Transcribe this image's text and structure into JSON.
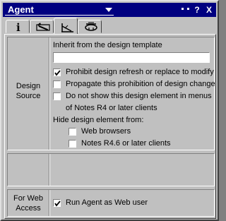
{
  "window": {
    "title": "Agent"
  },
  "title_controls": [
    "menu-icon",
    "help-icon",
    "close-icon"
  ],
  "tabs": [
    {
      "name": "info-tab",
      "icon": "info-icon",
      "active": false
    },
    {
      "name": "design-tab",
      "icon": "design-icon",
      "active": false
    },
    {
      "name": "design-source-tab",
      "icon": "design-source-icon",
      "active": true
    },
    {
      "name": "security-tab",
      "icon": "key-icon",
      "active": false
    }
  ],
  "title_help": "?",
  "title_close": "X",
  "tab_info_glyph": "i",
  "design_source": {
    "label_line1": "Design",
    "label_line2": "Source",
    "inherit_label": "Inherit from the design template",
    "inherit_value": "",
    "prohibit_refresh": {
      "label": "Prohibit design refresh or replace to modify",
      "checked": true
    },
    "propagate": {
      "label": "Propagate this prohibition of design change",
      "checked": false
    },
    "hide_menus": {
      "label_line1": "Do not show this design element in menus",
      "label_line2": "of Notes R4 or later clients",
      "checked": false
    },
    "hide_from_label": "Hide design element from:",
    "web_browsers": {
      "label": "Web browsers",
      "checked": false
    },
    "notes_r46": {
      "label": "Notes R4.6 or later clients",
      "checked": false
    }
  },
  "web_access": {
    "label_line1": "For Web",
    "label_line2": "Access",
    "run_as_web_user": {
      "label": "Run Agent as Web user",
      "checked": true
    }
  }
}
